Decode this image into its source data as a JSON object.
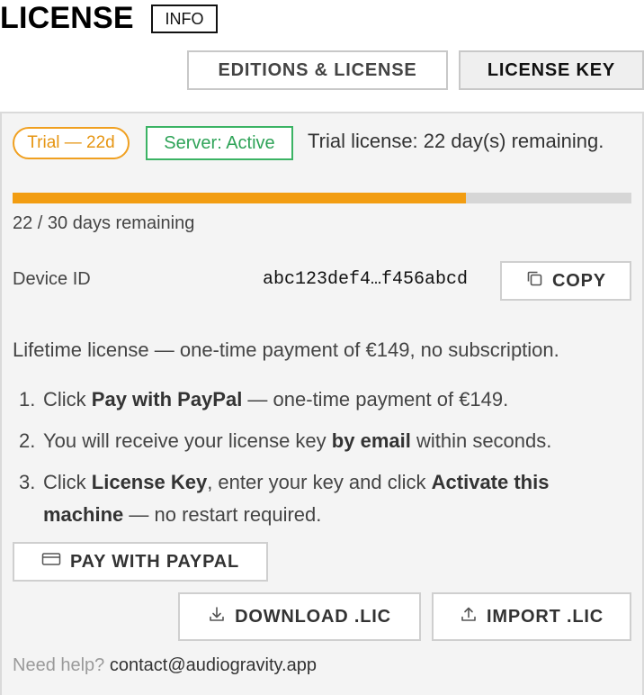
{
  "header": {
    "title": "LICENSE",
    "info_badge": "INFO"
  },
  "tabs": [
    {
      "label": "EDITIONS & LICENSE"
    },
    {
      "label": "LICENSE KEY"
    }
  ],
  "status": {
    "trial_pill": "Trial — 22d",
    "server_pill": "Server: Active",
    "trial_message": "Trial license: 22 day(s) remaining.",
    "progress_fraction": 0.733,
    "days_remaining_text": "22 / 30 days remaining"
  },
  "device": {
    "label": "Device ID",
    "id_value": "abc123def4…f456abcd",
    "copy_label": "COPY"
  },
  "purchase": {
    "lifetime_text": "Lifetime license — one-time payment of €149, no subscription.",
    "steps": [
      {
        "num": "1.",
        "parts": [
          "Click ",
          "Pay with PayPal",
          " — one-time payment of €149."
        ]
      },
      {
        "num": "2.",
        "parts": [
          "You will receive your license key ",
          "by email",
          " within seconds."
        ]
      },
      {
        "num": "3.",
        "parts": [
          "Click ",
          "License Key",
          ", enter your key and click ",
          "Activate this machine",
          " — no restart required."
        ]
      }
    ],
    "paypal_label": "PAY WITH PAYPAL",
    "download_label": "DOWNLOAD .LIC",
    "import_label": "IMPORT .LIC"
  },
  "help": {
    "prefix": "Need help?",
    "contact": "contact@audiogravity.app"
  },
  "icons": {
    "copy": "copy-icon",
    "card": "credit-card-icon",
    "download": "download-icon",
    "upload": "upload-icon"
  },
  "colors": {
    "accent_orange": "#f29d12",
    "active_green": "#3bb364",
    "panel_bg": "#f4f4f4"
  }
}
